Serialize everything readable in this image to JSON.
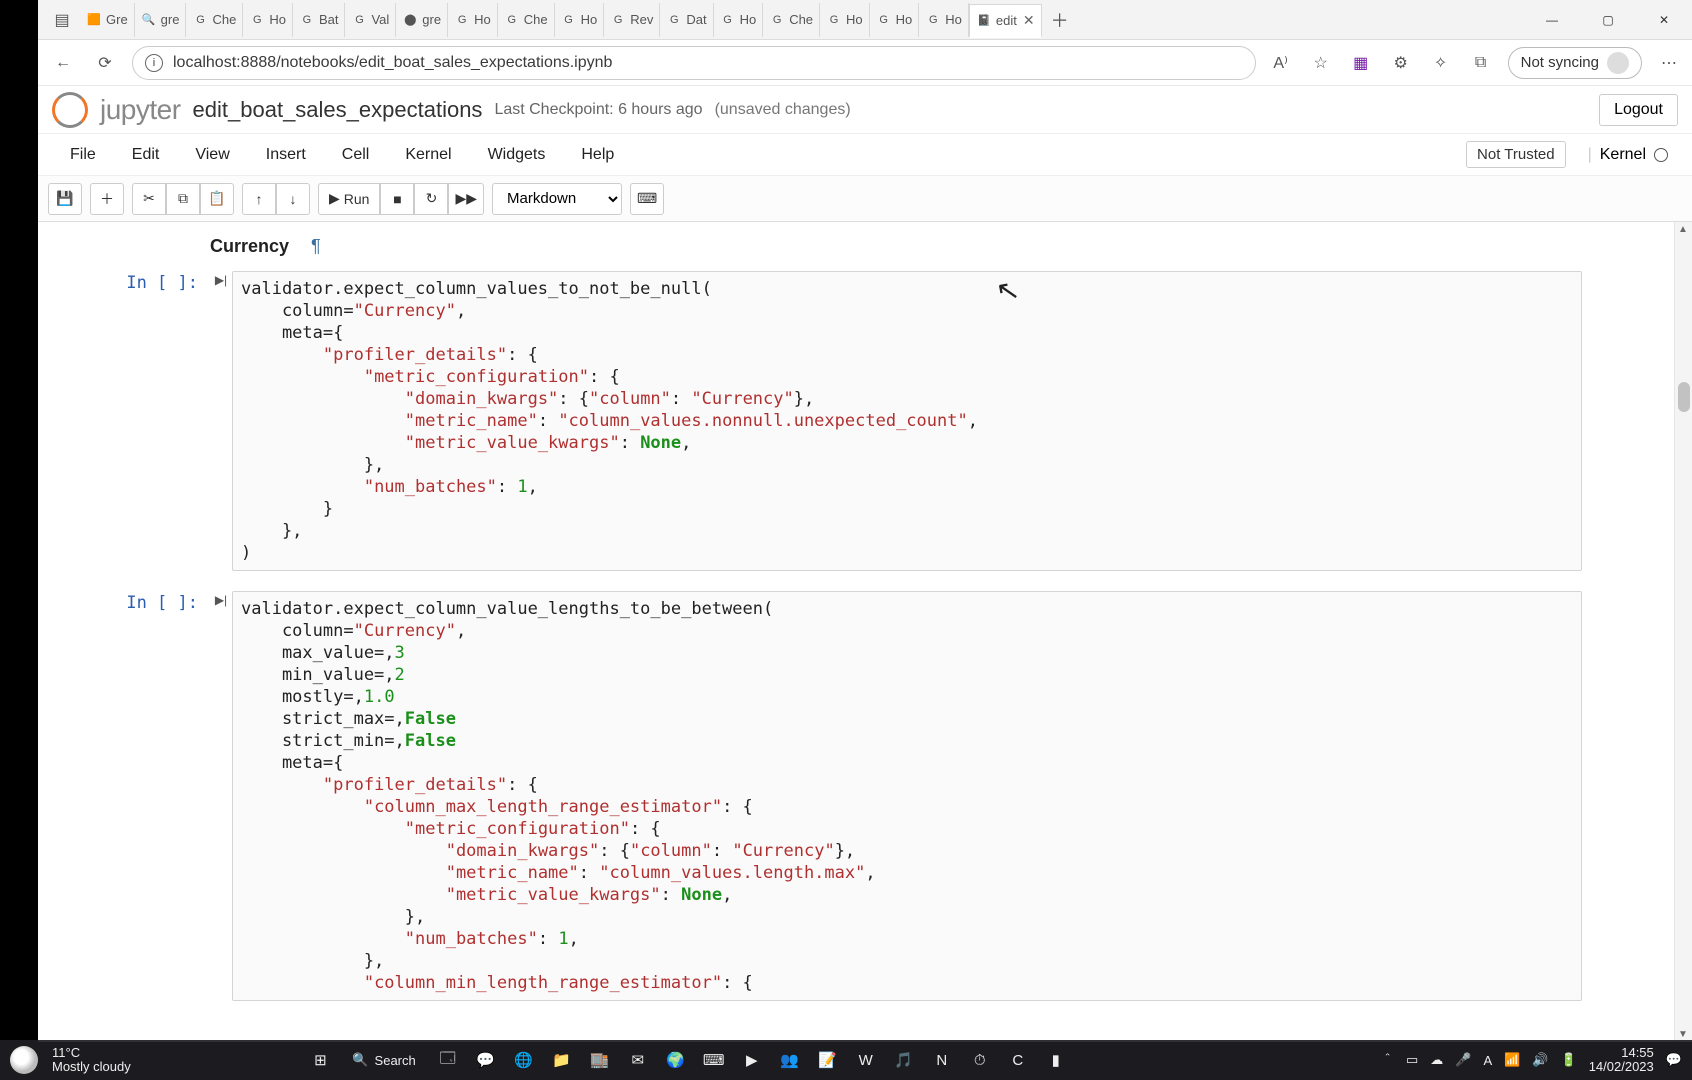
{
  "browser": {
    "tabs": [
      {
        "favicon": "🟧",
        "label": "Gre"
      },
      {
        "favicon": "🔍",
        "label": "gre"
      },
      {
        "favicon": "G",
        "label": "Che"
      },
      {
        "favicon": "G",
        "label": "Ho"
      },
      {
        "favicon": "G",
        "label": "Bat"
      },
      {
        "favicon": "G",
        "label": "Val"
      },
      {
        "favicon": "⬤",
        "label": "gre"
      },
      {
        "favicon": "G",
        "label": "Ho"
      },
      {
        "favicon": "G",
        "label": "Che"
      },
      {
        "favicon": "G",
        "label": "Ho"
      },
      {
        "favicon": "G",
        "label": "Rev"
      },
      {
        "favicon": "G",
        "label": "Dat"
      },
      {
        "favicon": "G",
        "label": "Ho"
      },
      {
        "favicon": "G",
        "label": "Che"
      },
      {
        "favicon": "G",
        "label": "Ho"
      },
      {
        "favicon": "G",
        "label": "Ho"
      },
      {
        "favicon": "G",
        "label": "Ho"
      }
    ],
    "active_tab": {
      "favicon": "📓",
      "label": "edit",
      "close": "✕"
    },
    "url": "localhost:8888/notebooks/edit_boat_sales_expectations.ipynb",
    "sync_label": "Not syncing"
  },
  "jupyter": {
    "brand": "jupyter",
    "notebook_name": "edit_boat_sales_expectations",
    "checkpoint": "Last Checkpoint: 6 hours ago",
    "unsaved": "(unsaved changes)",
    "logout": "Logout",
    "menus": [
      "File",
      "Edit",
      "View",
      "Insert",
      "Cell",
      "Kernel",
      "Widgets",
      "Help"
    ],
    "trusted": "Not Trusted",
    "kernel_label": "Kernel",
    "toolbar": {
      "run_label": "Run",
      "cell_type": "Markdown"
    }
  },
  "notebook": {
    "heading": "Currency",
    "anchor": "¶",
    "prompt": "In [ ]:",
    "code1": [
      {
        "t": "validator.expect_column_values_to_not_be_null("
      },
      {
        "t": "    column=",
        "s": "\"Currency\"",
        "t2": ","
      },
      {
        "t": "    meta={"
      },
      {
        "t": "        ",
        "s": "\"profiler_details\"",
        "t2": ": {"
      },
      {
        "t": "            ",
        "s": "\"metric_configuration\"",
        "t2": ": {"
      },
      {
        "t": "                ",
        "s": "\"domain_kwargs\"",
        "t2": ": {",
        "s2": "\"column\"",
        "t3": ": ",
        "s3": "\"Currency\"",
        "t4": "},"
      },
      {
        "t": "                ",
        "s": "\"metric_name\"",
        "t2": ": ",
        "s2": "\"column_values.nonnull.unexpected_count\"",
        "t3": ","
      },
      {
        "t": "                ",
        "s": "\"metric_value_kwargs\"",
        "t2": ": ",
        "k": "None",
        "t3": ","
      },
      {
        "t": "            },"
      },
      {
        "t": "            ",
        "s": "\"num_batches\"",
        "t2": ": ",
        "n": "1",
        "t3": ","
      },
      {
        "t": "        }"
      },
      {
        "t": "    },"
      },
      {
        "t": ")"
      }
    ],
    "code2": [
      {
        "t": "validator.expect_column_value_lengths_to_be_between("
      },
      {
        "t": "    column=",
        "s": "\"Currency\"",
        "t2": ","
      },
      {
        "t": "    max_value=",
        "n": "3",
        "t2": ","
      },
      {
        "t": "    min_value=",
        "n": "2",
        "t2": ","
      },
      {
        "t": "    mostly=",
        "n": "1.0",
        "t2": ","
      },
      {
        "t": "    strict_max=",
        "k": "False",
        "t2": ","
      },
      {
        "t": "    strict_min=",
        "k": "False",
        "t2": ","
      },
      {
        "t": "    meta={"
      },
      {
        "t": "        ",
        "s": "\"profiler_details\"",
        "t2": ": {"
      },
      {
        "t": "            ",
        "s": "\"column_max_length_range_estimator\"",
        "t2": ": {"
      },
      {
        "t": "                ",
        "s": "\"metric_configuration\"",
        "t2": ": {"
      },
      {
        "t": "                    ",
        "s": "\"domain_kwargs\"",
        "t2": ": {",
        "s2": "\"column\"",
        "t3": ": ",
        "s3": "\"Currency\"",
        "t4": "},"
      },
      {
        "t": "                    ",
        "s": "\"metric_name\"",
        "t2": ": ",
        "s2": "\"column_values.length.max\"",
        "t3": ","
      },
      {
        "t": "                    ",
        "s": "\"metric_value_kwargs\"",
        "t2": ": ",
        "k": "None",
        "t3": ","
      },
      {
        "t": "                },"
      },
      {
        "t": "                ",
        "s": "\"num_batches\"",
        "t2": ": ",
        "n": "1",
        "t3": ","
      },
      {
        "t": "            },"
      },
      {
        "t": "            ",
        "s": "\"column_min_length_range_estimator\"",
        "t2": ": {"
      }
    ]
  },
  "taskbar": {
    "temp": "11°C",
    "weather": "Mostly cloudy",
    "search": "Search",
    "time": "14:55",
    "date": "14/02/2023",
    "apps": [
      "⊞",
      "🔍",
      "🗔",
      "💬",
      "🌐",
      "📁",
      "🏬",
      "✉",
      "🌍",
      "⌨",
      "▶",
      "👥",
      "📝",
      "W",
      "🎵",
      "N",
      "⏱",
      "C",
      "▮"
    ]
  }
}
